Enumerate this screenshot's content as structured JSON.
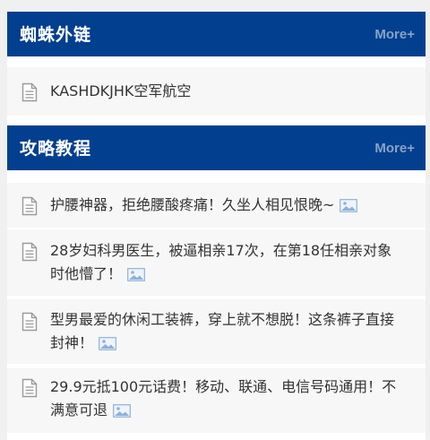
{
  "sections": [
    {
      "title": "蜘蛛外链",
      "more": "More+",
      "items": [
        {
          "text": "KASHDKJHK空军航空",
          "has_image": false
        }
      ]
    },
    {
      "title": "攻略教程",
      "more": "More+",
      "items": [
        {
          "text": "护腰神器，拒绝腰酸疼痛！久坐人相见恨晚~",
          "has_image": true
        },
        {
          "text": "28岁妇科男医生，被逼相亲17次，在第18任相亲对象时他懵了！",
          "has_image": true
        },
        {
          "text": "型男最爱的休闲工装裤，穿上就不想脱！这条裤子直接封神！",
          "has_image": true
        },
        {
          "text": "29.9元抵100元话费！移动、联通、电信号码通用！不满意可退",
          "has_image": true
        }
      ]
    }
  ],
  "icons": {
    "item": "document-icon",
    "image_flag": "image-icon"
  },
  "colors": {
    "header_bg": "#033f8f",
    "header_text": "#ffffff",
    "more_text": "#8aa2c4",
    "item_bg": "#f7f7f7",
    "text": "#333333"
  }
}
